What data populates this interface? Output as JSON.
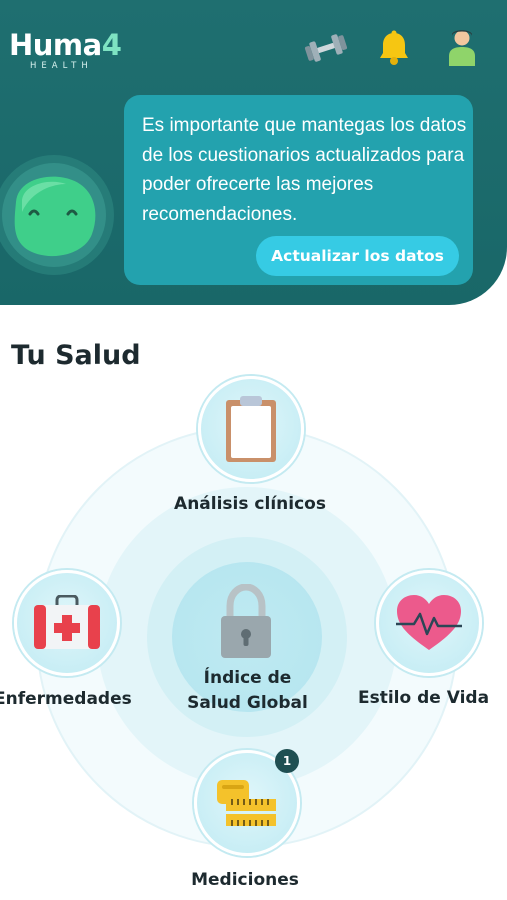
{
  "header": {
    "logo": {
      "text_main": "Huma",
      "text_accent_char": "4",
      "text_sub": "HEALTH"
    },
    "icons": [
      "dumbbell-icon",
      "bell-icon",
      "user-icon"
    ],
    "colors": {
      "background": "#1f6f70",
      "bubble": "#23a2ae",
      "button": "#36cbe4",
      "bell": "#f6c612"
    }
  },
  "banner": {
    "message": "Es importante que mantegas los datos de los cuestionarios actualizados para poder ofrecerte las mejores recomendaciones.",
    "button_label": "Actualizar los datos"
  },
  "section": {
    "title": "Tu Salud"
  },
  "health_map": {
    "center": {
      "line1": "Índice de",
      "line2": "Salud Global",
      "icon": "lock-icon"
    },
    "nodes": {
      "top": {
        "label": "Análisis clínicos",
        "icon": "clipboard-icon"
      },
      "left": {
        "label": "Enfermedades",
        "icon": "first-aid-kit-icon"
      },
      "right": {
        "label": "Estilo de Vida",
        "icon": "heart-pulse-icon"
      },
      "bottom": {
        "label": "Mediciones",
        "icon": "tape-measure-icon",
        "badge": "1"
      }
    }
  }
}
